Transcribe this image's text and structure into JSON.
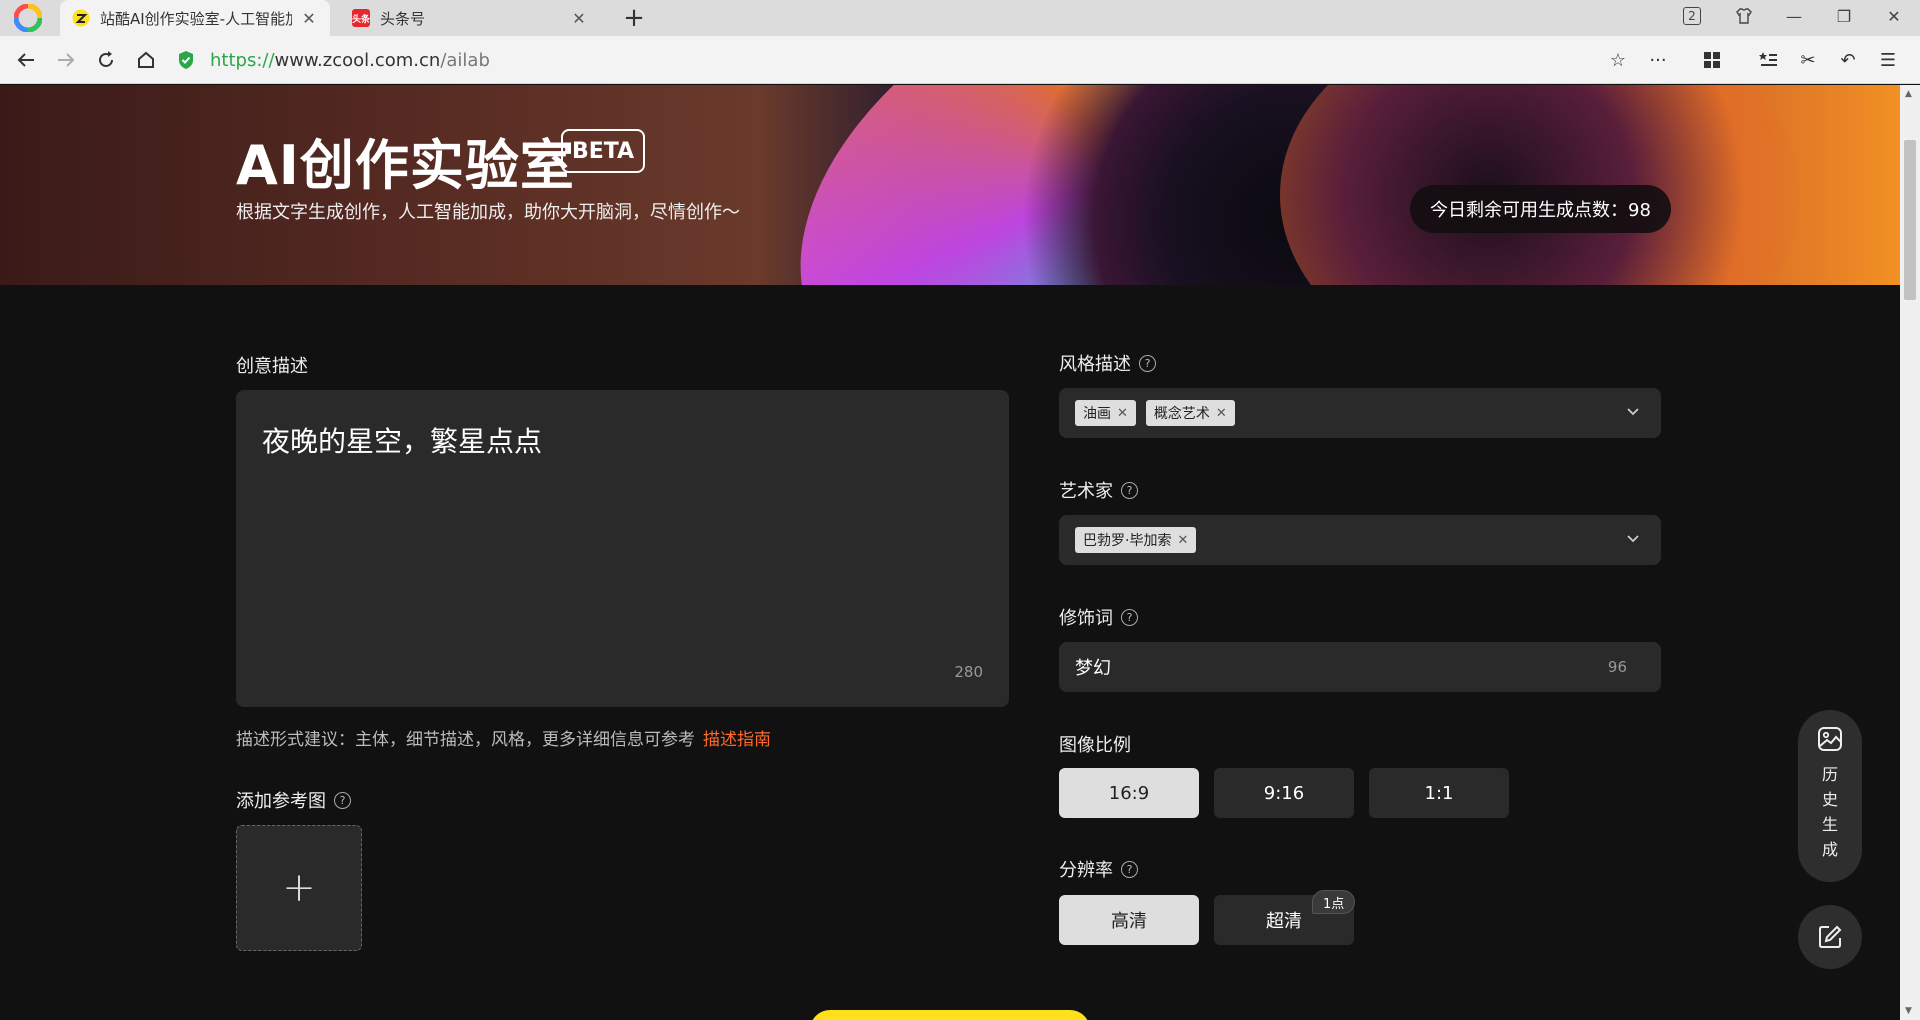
{
  "browser": {
    "tabs": [
      {
        "label": "站酷AI创作实验室-人工智能加",
        "active": true
      },
      {
        "label": "头条号",
        "active": false
      }
    ],
    "tab_count": "2",
    "toutiao_favicon_text": "头条",
    "url": {
      "scheme": "https://",
      "host": "www.zcool.com.cn",
      "path": "/ailab"
    }
  },
  "banner": {
    "title": "AI创作实验室",
    "beta": "BETA",
    "subtitle": "根据文字生成创作，人工智能加成，助你大开脑洞，尽情创作～",
    "credits": "今日剩余可用生成点数：98"
  },
  "description": {
    "label": "创意描述",
    "value": "夜晚的星空，繁星点点",
    "count": "280",
    "hint": "描述形式建议：主体，细节描述，风格，更多详细信息可参考",
    "guide_link": "描述指南"
  },
  "reference": {
    "label": "添加参考图",
    "add_icon": "+"
  },
  "style": {
    "label": "风格描述",
    "tags": [
      "油画",
      "概念艺术"
    ]
  },
  "artist": {
    "label": "艺术家",
    "tags": [
      "巴勃罗·毕加索"
    ]
  },
  "modifier": {
    "label": "修饰词",
    "value": "梦幻",
    "count": "96"
  },
  "ratio": {
    "label": "图像比例",
    "options": [
      "16:9",
      "9:16",
      "1:1"
    ],
    "selected": "16:9"
  },
  "resolution": {
    "label": "分辨率",
    "options": [
      "高清",
      "超清"
    ],
    "selected": "高清",
    "badge": "1点"
  },
  "floating": {
    "history_label": [
      "历",
      "史",
      "生",
      "成"
    ]
  },
  "colors": {
    "accent_link": "#ff6a2c",
    "generate_button": "#ffe01a",
    "secure_green": "#2aa748"
  }
}
